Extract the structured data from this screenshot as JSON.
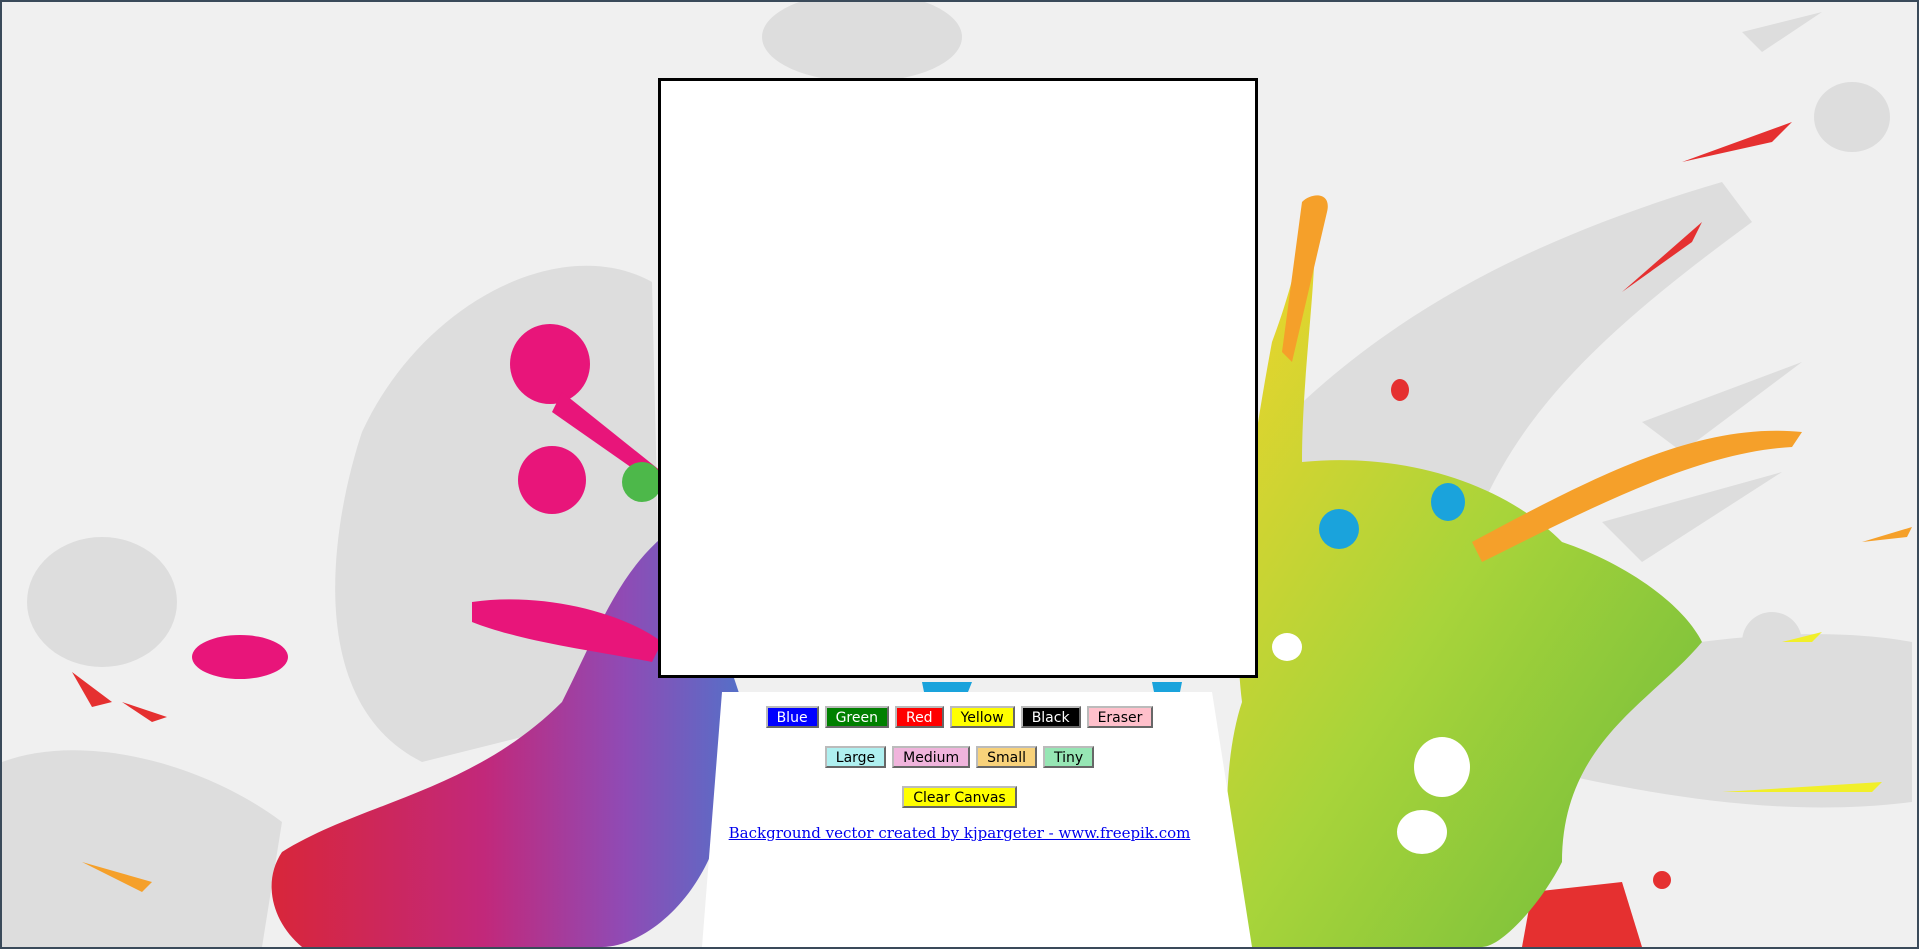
{
  "colors": {
    "page_bg": "#f0f0f0",
    "splash_gray": "#dddddd",
    "canvas_bg": "#ffffff",
    "link": "#0000ee"
  },
  "color_buttons": [
    {
      "label": "Blue",
      "bg": "#0000ff",
      "fg": "#ffffff"
    },
    {
      "label": "Green",
      "bg": "#008000",
      "fg": "#ffffff"
    },
    {
      "label": "Red",
      "bg": "#ff0000",
      "fg": "#ffffff"
    },
    {
      "label": "Yellow",
      "bg": "#ffff00",
      "fg": "#000000"
    },
    {
      "label": "Black",
      "bg": "#000000",
      "fg": "#ffffff"
    },
    {
      "label": "Eraser",
      "bg": "#ffc0cb",
      "fg": "#000000"
    }
  ],
  "size_buttons": [
    {
      "label": "Large",
      "bg": "#aff0f0",
      "fg": "#000000"
    },
    {
      "label": "Medium",
      "bg": "#f0b4dc",
      "fg": "#000000"
    },
    {
      "label": "Small",
      "bg": "#f8d27a",
      "fg": "#000000"
    },
    {
      "label": "Tiny",
      "bg": "#96e6b4",
      "fg": "#000000"
    }
  ],
  "clear_button": {
    "label": "Clear Canvas",
    "bg": "#ffff00",
    "fg": "#000000"
  },
  "credit": {
    "text": "Background vector created by kjpargeter - www.freepik.com"
  }
}
